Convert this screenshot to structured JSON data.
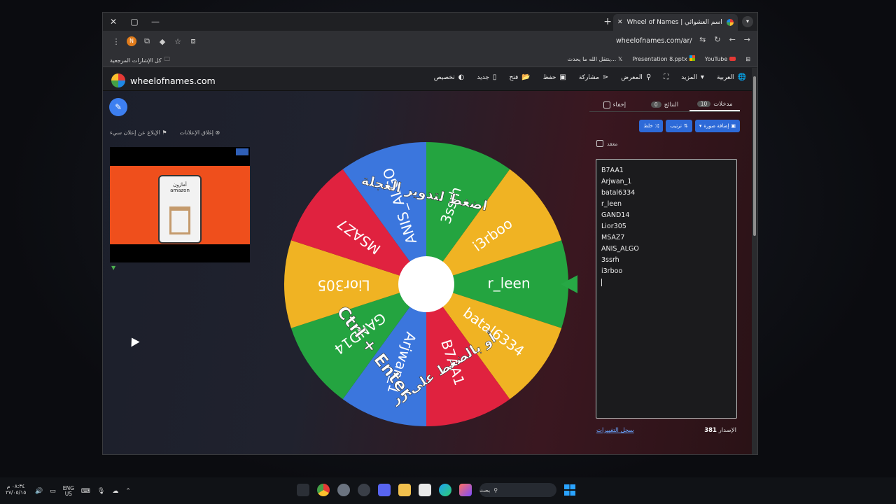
{
  "browser": {
    "tab_title": "Wheel of Names | اسم العشوائي",
    "url": "wheelofnames.com/ar/",
    "bookmarks_folder": "كل الإشارات المرجعية",
    "bookmarks": [
      "YouTube",
      "Presentation 8.pptx",
      "ينتقل الله ما يحدث..."
    ]
  },
  "app": {
    "logo_text": "wheelofnames.com",
    "menu": [
      "تخصيص",
      "جديد",
      "فتح",
      "حفظ",
      "مشاركة",
      "المعرض",
      "المزيد",
      "العربية"
    ]
  },
  "ad": {
    "report_link": "الإبلاغ عن إعلان سيء",
    "close_link": "إغلاق الإعلانات",
    "brand": "amazon",
    "brand_ar": "أمازون"
  },
  "wheel": {
    "overlay_line1": "اضغط لتدوير العجلة",
    "overlay_line2": "أو بالضغط على زر",
    "overlay_line3": "Ctrl + Enter",
    "colors": [
      "#e0223f",
      "#3b76dd",
      "#24a440",
      "#f0b323"
    ]
  },
  "side": {
    "tabs": {
      "entries": "مدخلات",
      "entries_count": "10",
      "results": "النتائج",
      "results_count": "0",
      "hide": "إخفاء"
    },
    "buttons": {
      "shuffle": "خلط",
      "sort": "ترتيب",
      "add_image": "إضافة صورة"
    },
    "advanced": "معقد",
    "entries": [
      "B7AA1",
      "Arjwan_1",
      "batal6334",
      "r_leen",
      "GAND14",
      "Lior305",
      "MSAZ7",
      "ANIS_ALGO",
      "3ssrh",
      "i3rboo"
    ],
    "version_label": "الإصدار",
    "version": "381",
    "changelog": "سجل التغييرات"
  },
  "taskbar": {
    "time": "٠٨:٣٤ م",
    "date": "٢٧/٠٥/١٥",
    "lang1": "ENG",
    "lang2": "US",
    "search": "بحث"
  }
}
